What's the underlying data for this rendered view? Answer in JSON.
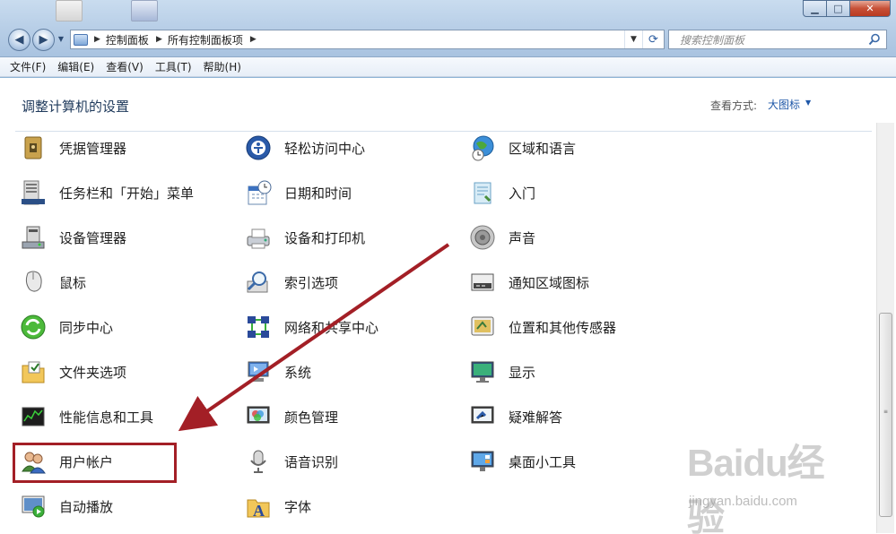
{
  "window": {
    "min_symbol": "▁",
    "max_symbol": "□",
    "close_symbol": "✕"
  },
  "address": {
    "crumbs": [
      "控制面板",
      "所有控制面板项"
    ],
    "search_placeholder": "搜索控制面板"
  },
  "menu": [
    "文件(F)",
    "编辑(E)",
    "查看(V)",
    "工具(T)",
    "帮助(H)"
  ],
  "header": {
    "title": "调整计算机的设置",
    "view_label": "查看方式:",
    "view_value": "大图标"
  },
  "items": [
    {
      "label": "凭据管理器",
      "icon": "credential-manager-icon"
    },
    {
      "label": "轻松访问中心",
      "icon": "ease-of-access-icon"
    },
    {
      "label": "区域和语言",
      "icon": "region-language-icon"
    },
    {
      "label": "任务栏和「开始」菜单",
      "icon": "taskbar-start-menu-icon"
    },
    {
      "label": "日期和时间",
      "icon": "date-time-icon"
    },
    {
      "label": "入门",
      "icon": "getting-started-icon"
    },
    {
      "label": "设备管理器",
      "icon": "device-manager-icon"
    },
    {
      "label": "设备和打印机",
      "icon": "devices-printers-icon"
    },
    {
      "label": "声音",
      "icon": "sound-icon"
    },
    {
      "label": "鼠标",
      "icon": "mouse-icon"
    },
    {
      "label": "索引选项",
      "icon": "indexing-options-icon"
    },
    {
      "label": "通知区域图标",
      "icon": "notification-area-icon"
    },
    {
      "label": "同步中心",
      "icon": "sync-center-icon"
    },
    {
      "label": "网络和共享中心",
      "icon": "network-sharing-icon"
    },
    {
      "label": "位置和其他传感器",
      "icon": "location-sensors-icon"
    },
    {
      "label": "文件夹选项",
      "icon": "folder-options-icon"
    },
    {
      "label": "系统",
      "icon": "system-icon"
    },
    {
      "label": "显示",
      "icon": "display-icon"
    },
    {
      "label": "性能信息和工具",
      "icon": "performance-icon"
    },
    {
      "label": "颜色管理",
      "icon": "color-management-icon"
    },
    {
      "label": "疑难解答",
      "icon": "troubleshooting-icon"
    },
    {
      "label": "用户帐户",
      "icon": "user-accounts-icon"
    },
    {
      "label": "语音识别",
      "icon": "speech-recognition-icon"
    },
    {
      "label": "桌面小工具",
      "icon": "desktop-gadgets-icon"
    },
    {
      "label": "自动播放",
      "icon": "autoplay-icon"
    },
    {
      "label": "字体",
      "icon": "fonts-icon"
    }
  ],
  "watermark": {
    "logo": "Baidu经验",
    "url": "jingyan.baidu.com"
  },
  "colors": {
    "highlight": "#a31f26",
    "link": "#1f58a8"
  }
}
